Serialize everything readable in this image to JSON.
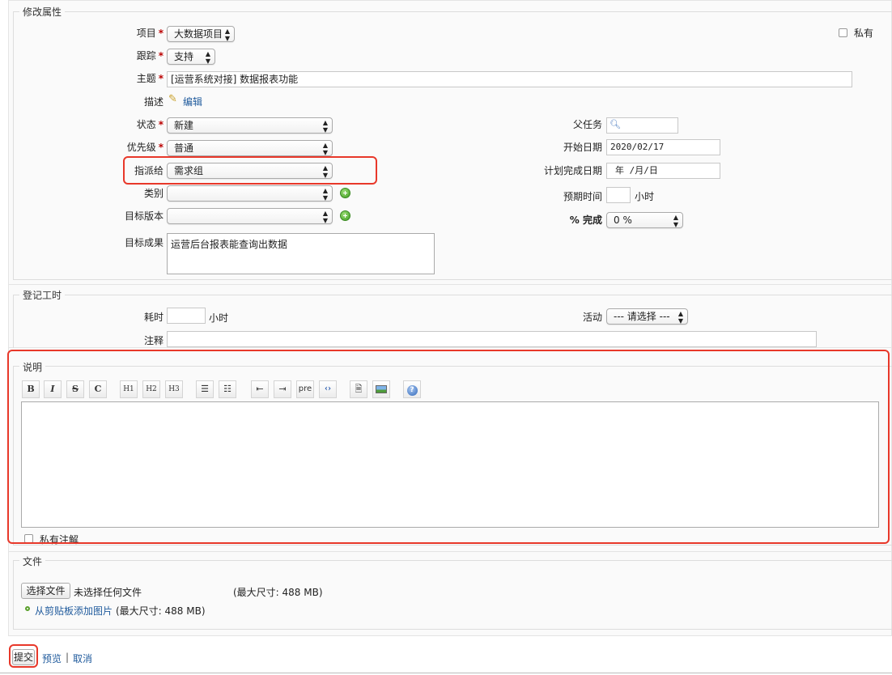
{
  "attributes": {
    "legend": "修改属性",
    "project_label": "项目",
    "project_value": "大数据项目",
    "private_label": "私有",
    "tracker_label": "跟踪",
    "tracker_value": "支持",
    "subject_label": "主题",
    "subject_value": "[运营系统对接] 数据报表功能",
    "description_label": "描述",
    "edit_link": "编辑",
    "status_label": "状态",
    "status_value": "新建",
    "priority_label": "优先级",
    "priority_value": "普通",
    "assignee_label": "指派给",
    "assignee_value": "需求组",
    "category_label": "类别",
    "category_value": "",
    "version_label": "目标版本",
    "version_value": "",
    "target_label": "目标成果",
    "target_value": "运营后台报表能查询出数据",
    "parent_label": "父任务",
    "parent_value": "",
    "start_label": "开始日期",
    "start_value": "2020/02/17",
    "due_label": "计划完成日期",
    "due_value": "年 /月/日",
    "estimate_label": "预期时间",
    "estimate_value": "",
    "hours_unit": "小时",
    "done_label": "% 完成",
    "done_value": "0 %"
  },
  "time_log": {
    "legend": "登记工时",
    "spent_label": "耗时",
    "spent_value": "",
    "hours_unit": "小时",
    "activity_label": "活动",
    "activity_value": "--- 请选择 ---",
    "comment_label": "注释",
    "comment_value": ""
  },
  "notes": {
    "legend": "说明",
    "toolbar": [
      "B",
      "I",
      "S",
      "C",
      "H1",
      "H2",
      "H3",
      "pre"
    ],
    "text": "",
    "private_notes_label": "私有注解"
  },
  "files": {
    "legend": "文件",
    "choose_button": "选择文件",
    "no_file": "未选择任何文件",
    "max_size": "(最大尺寸: 488 MB)",
    "paste_link": "从剪贴板添加图片",
    "paste_max": "(最大尺寸: 488 MB)"
  },
  "actions": {
    "submit": "提交",
    "preview": "预览",
    "separator": "|",
    "cancel": "取消"
  },
  "colors": {
    "required": "#bb0000",
    "link": "#1f5a9c",
    "highlight": "#e8382a"
  }
}
